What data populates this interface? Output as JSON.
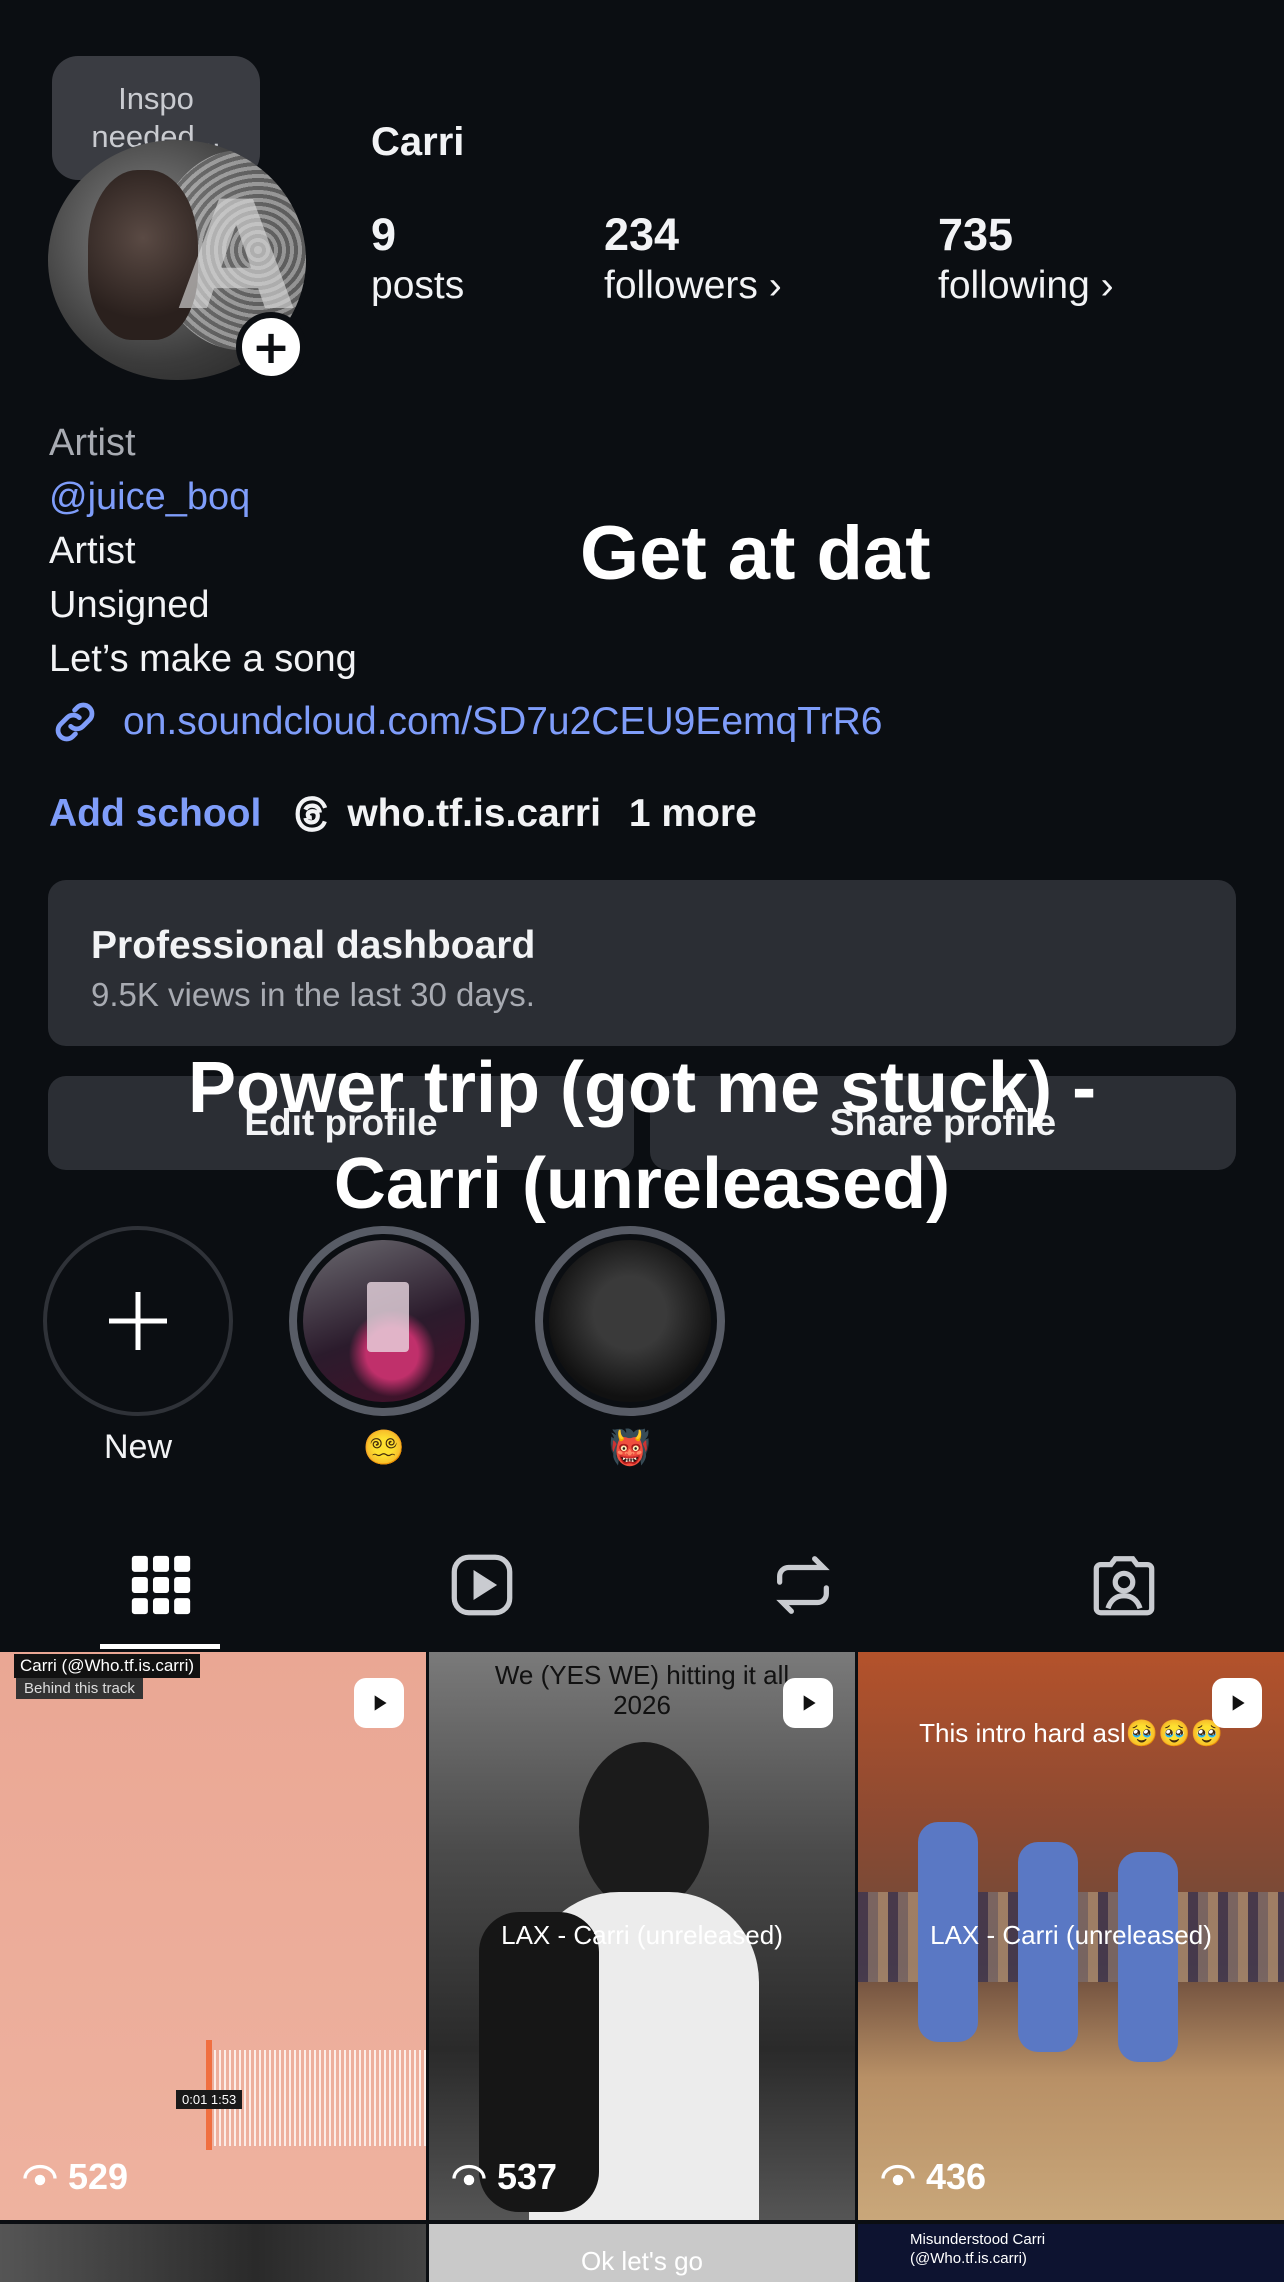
{
  "profile": {
    "note": "Inspo needed...",
    "username": "Carri",
    "stats": [
      {
        "value": "9",
        "label": "posts"
      },
      {
        "value": "234",
        "label": "followers ›"
      },
      {
        "value": "735",
        "label": "following ›"
      }
    ],
    "bio": {
      "category": "Artist",
      "handle": "@juice_boq",
      "line1": "Artist",
      "line2": "Unsigned",
      "line3": "Let’s make a song"
    },
    "link": "on.soundcloud.com/SD7u2CEU9EemqTrR6",
    "add_school": "Add school",
    "threads_handle": "who.tf.is.carri",
    "more": "1 more"
  },
  "dashboard": {
    "title": "Professional dashboard",
    "subtitle": "9.5K views in the last 30 days."
  },
  "buttons": {
    "edit": "Edit profile",
    "share": "Share profile"
  },
  "overlays": {
    "get_at_dat": "Get at dat",
    "power_trip_1": "Power trip (got me stuck) -",
    "power_trip_2": "Carri (unreleased)"
  },
  "highlights": [
    {
      "label": "New"
    },
    {
      "label": "😵‍💫"
    },
    {
      "label": "👹"
    }
  ],
  "tabs": [
    "grid-icon",
    "reels-icon",
    "reposts-icon",
    "tagged-icon"
  ],
  "grid": [
    {
      "views": "529",
      "caption_top": "Carri (@Who.tf.is.carri)",
      "tag": "Behind this track",
      "time": "0:01  1:53"
    },
    {
      "views": "537",
      "caption_top": "We (YES WE) hitting it all 2026",
      "caption_mid": "LAX - Carri (unreleased)"
    },
    {
      "views": "436",
      "caption_top": "This intro hard asl🥹🥹🥹",
      "caption_mid": "LAX - Carri (unreleased)"
    }
  ],
  "grid_row2": [
    {
      "caption": ""
    },
    {
      "caption": "Ok let's go"
    },
    {
      "caption": "Misunderstood Carri (@Who.tf.is.carri)"
    }
  ],
  "colors": {
    "background": "#0b0e12",
    "card": "#2b2e34",
    "link": "#7f9dfa"
  }
}
